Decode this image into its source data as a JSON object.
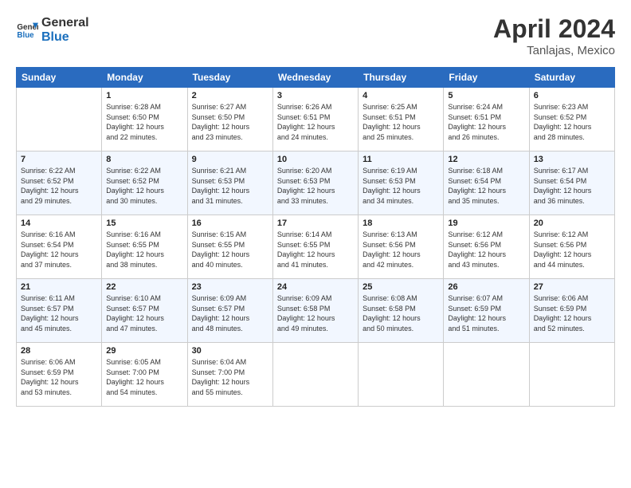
{
  "header": {
    "logo_general": "General",
    "logo_blue": "Blue",
    "month": "April 2024",
    "location": "Tanlajas, Mexico"
  },
  "columns": [
    "Sunday",
    "Monday",
    "Tuesday",
    "Wednesday",
    "Thursday",
    "Friday",
    "Saturday"
  ],
  "weeks": [
    [
      {
        "day": "",
        "detail": ""
      },
      {
        "day": "1",
        "detail": "Sunrise: 6:28 AM\nSunset: 6:50 PM\nDaylight: 12 hours\nand 22 minutes."
      },
      {
        "day": "2",
        "detail": "Sunrise: 6:27 AM\nSunset: 6:50 PM\nDaylight: 12 hours\nand 23 minutes."
      },
      {
        "day": "3",
        "detail": "Sunrise: 6:26 AM\nSunset: 6:51 PM\nDaylight: 12 hours\nand 24 minutes."
      },
      {
        "day": "4",
        "detail": "Sunrise: 6:25 AM\nSunset: 6:51 PM\nDaylight: 12 hours\nand 25 minutes."
      },
      {
        "day": "5",
        "detail": "Sunrise: 6:24 AM\nSunset: 6:51 PM\nDaylight: 12 hours\nand 26 minutes."
      },
      {
        "day": "6",
        "detail": "Sunrise: 6:23 AM\nSunset: 6:52 PM\nDaylight: 12 hours\nand 28 minutes."
      }
    ],
    [
      {
        "day": "7",
        "detail": "Sunrise: 6:22 AM\nSunset: 6:52 PM\nDaylight: 12 hours\nand 29 minutes."
      },
      {
        "day": "8",
        "detail": "Sunrise: 6:22 AM\nSunset: 6:52 PM\nDaylight: 12 hours\nand 30 minutes."
      },
      {
        "day": "9",
        "detail": "Sunrise: 6:21 AM\nSunset: 6:53 PM\nDaylight: 12 hours\nand 31 minutes."
      },
      {
        "day": "10",
        "detail": "Sunrise: 6:20 AM\nSunset: 6:53 PM\nDaylight: 12 hours\nand 33 minutes."
      },
      {
        "day": "11",
        "detail": "Sunrise: 6:19 AM\nSunset: 6:53 PM\nDaylight: 12 hours\nand 34 minutes."
      },
      {
        "day": "12",
        "detail": "Sunrise: 6:18 AM\nSunset: 6:54 PM\nDaylight: 12 hours\nand 35 minutes."
      },
      {
        "day": "13",
        "detail": "Sunrise: 6:17 AM\nSunset: 6:54 PM\nDaylight: 12 hours\nand 36 minutes."
      }
    ],
    [
      {
        "day": "14",
        "detail": "Sunrise: 6:16 AM\nSunset: 6:54 PM\nDaylight: 12 hours\nand 37 minutes."
      },
      {
        "day": "15",
        "detail": "Sunrise: 6:16 AM\nSunset: 6:55 PM\nDaylight: 12 hours\nand 38 minutes."
      },
      {
        "day": "16",
        "detail": "Sunrise: 6:15 AM\nSunset: 6:55 PM\nDaylight: 12 hours\nand 40 minutes."
      },
      {
        "day": "17",
        "detail": "Sunrise: 6:14 AM\nSunset: 6:55 PM\nDaylight: 12 hours\nand 41 minutes."
      },
      {
        "day": "18",
        "detail": "Sunrise: 6:13 AM\nSunset: 6:56 PM\nDaylight: 12 hours\nand 42 minutes."
      },
      {
        "day": "19",
        "detail": "Sunrise: 6:12 AM\nSunset: 6:56 PM\nDaylight: 12 hours\nand 43 minutes."
      },
      {
        "day": "20",
        "detail": "Sunrise: 6:12 AM\nSunset: 6:56 PM\nDaylight: 12 hours\nand 44 minutes."
      }
    ],
    [
      {
        "day": "21",
        "detail": "Sunrise: 6:11 AM\nSunset: 6:57 PM\nDaylight: 12 hours\nand 45 minutes."
      },
      {
        "day": "22",
        "detail": "Sunrise: 6:10 AM\nSunset: 6:57 PM\nDaylight: 12 hours\nand 47 minutes."
      },
      {
        "day": "23",
        "detail": "Sunrise: 6:09 AM\nSunset: 6:57 PM\nDaylight: 12 hours\nand 48 minutes."
      },
      {
        "day": "24",
        "detail": "Sunrise: 6:09 AM\nSunset: 6:58 PM\nDaylight: 12 hours\nand 49 minutes."
      },
      {
        "day": "25",
        "detail": "Sunrise: 6:08 AM\nSunset: 6:58 PM\nDaylight: 12 hours\nand 50 minutes."
      },
      {
        "day": "26",
        "detail": "Sunrise: 6:07 AM\nSunset: 6:59 PM\nDaylight: 12 hours\nand 51 minutes."
      },
      {
        "day": "27",
        "detail": "Sunrise: 6:06 AM\nSunset: 6:59 PM\nDaylight: 12 hours\nand 52 minutes."
      }
    ],
    [
      {
        "day": "28",
        "detail": "Sunrise: 6:06 AM\nSunset: 6:59 PM\nDaylight: 12 hours\nand 53 minutes."
      },
      {
        "day": "29",
        "detail": "Sunrise: 6:05 AM\nSunset: 7:00 PM\nDaylight: 12 hours\nand 54 minutes."
      },
      {
        "day": "30",
        "detail": "Sunrise: 6:04 AM\nSunset: 7:00 PM\nDaylight: 12 hours\nand 55 minutes."
      },
      {
        "day": "",
        "detail": ""
      },
      {
        "day": "",
        "detail": ""
      },
      {
        "day": "",
        "detail": ""
      },
      {
        "day": "",
        "detail": ""
      }
    ]
  ]
}
